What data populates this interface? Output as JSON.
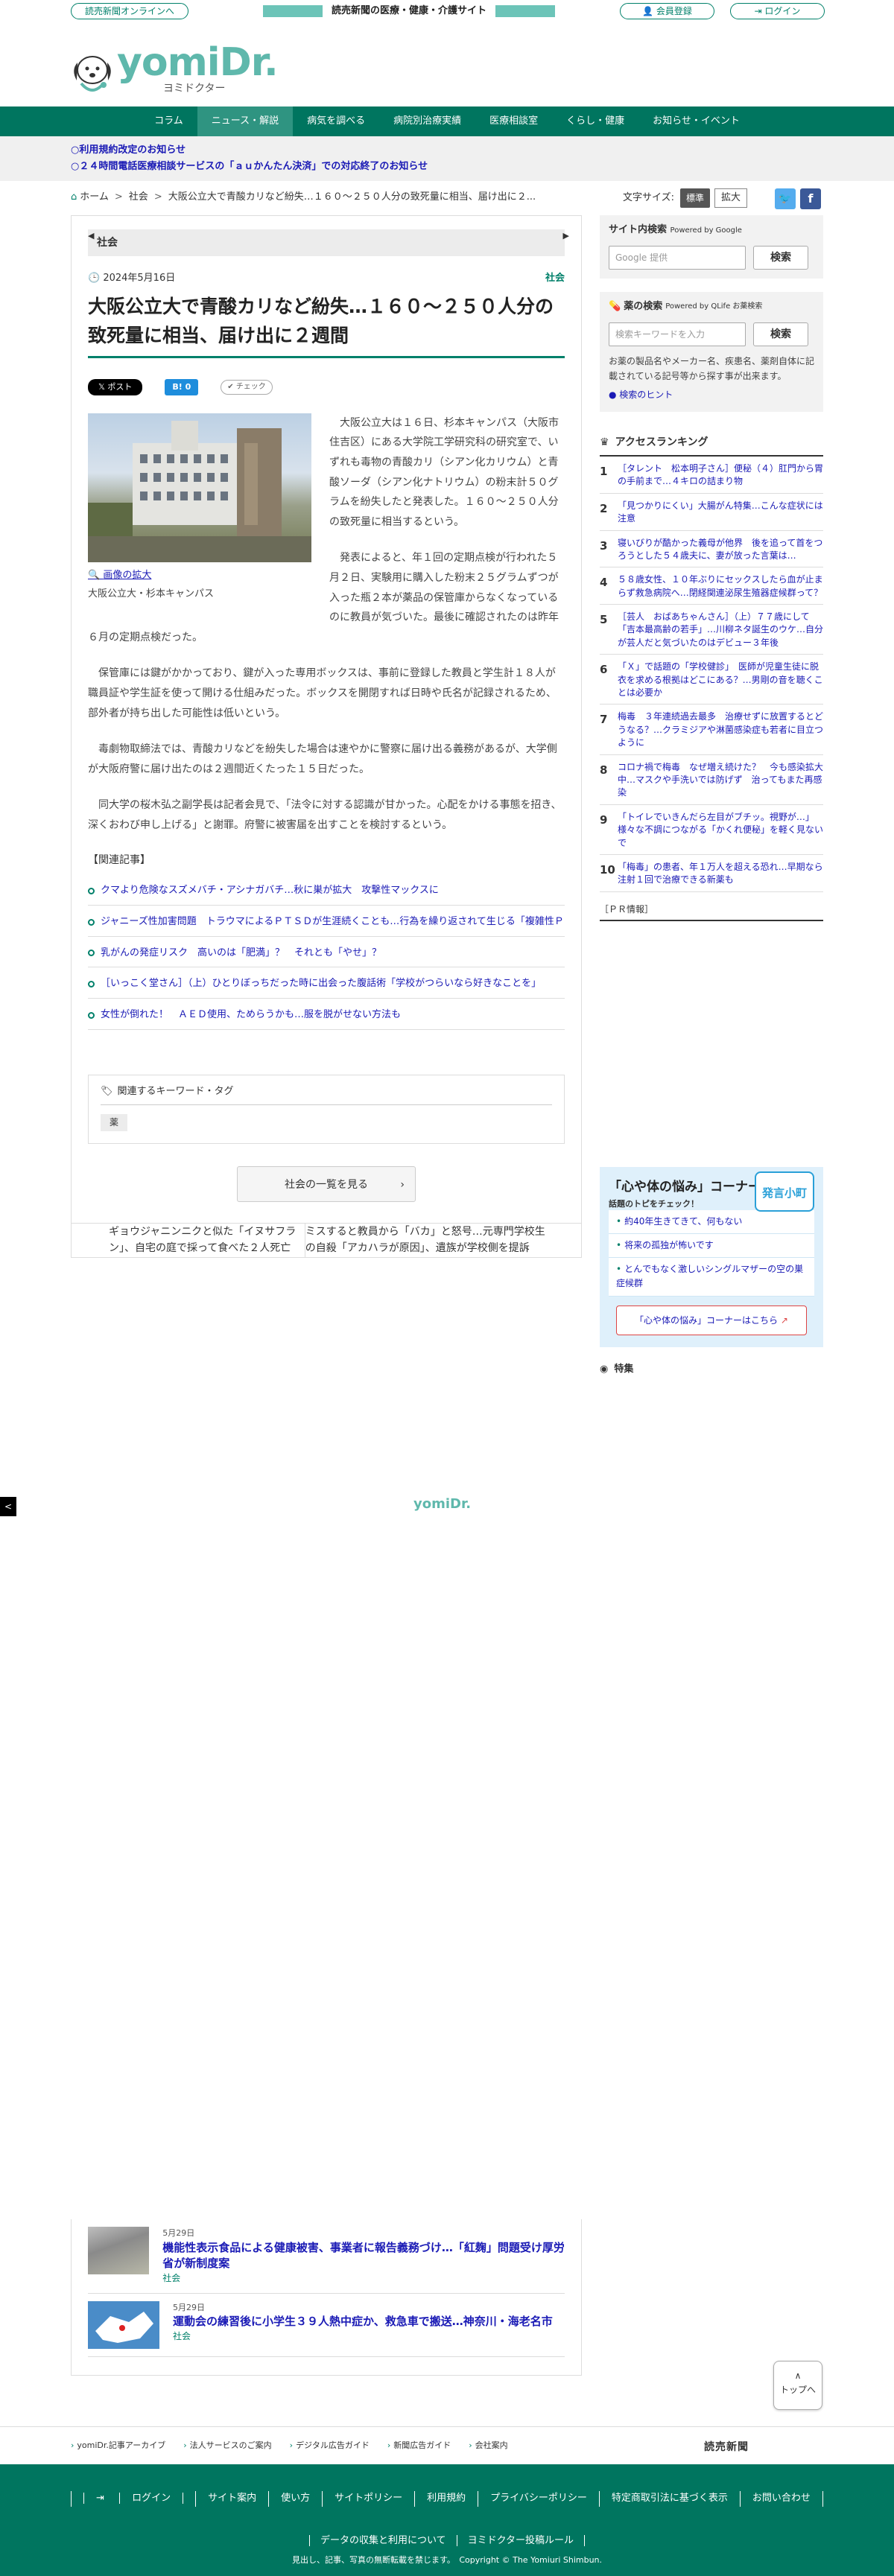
{
  "top": {
    "online": "読売新聞オンラインへ",
    "tagline": "読売新聞の医療・健康・介護サイト",
    "register": "会員登録",
    "login": "ログイン"
  },
  "logo": {
    "mark": "yomiDr.",
    "kana": "ヨミドクター"
  },
  "nav": [
    "コラム",
    "ニュース・解説",
    "病気を調べる",
    "病院別治療実績",
    "医療相談室",
    "くらし・健康",
    "お知らせ・イベント"
  ],
  "notices": [
    "○利用規約改定のお知らせ",
    "○２４時間電話医療相談サービスの「ａｕかんたん決済」での対応終了のお知らせ"
  ],
  "breadcrumb": {
    "home": "ホーム",
    "cat": "社会",
    "current": "大阪公立大で青酸カリなど紛失…１６０～２５０人分の致死量に相当、届け出に２..."
  },
  "textsize": {
    "label": "文字サイズ:",
    "std": "標準",
    "big": "拡大"
  },
  "article": {
    "section": "社会",
    "date": "2024年5月16日",
    "category": "社会",
    "title": "大阪公立大で青酸カリなど紛失…１６０～２５０人分の致死量に相当、届け出に２週間",
    "share_x": "ポスト",
    "share_b": "B! 0",
    "share_check": "チェック",
    "photo_zoom": "画像の拡大",
    "photo_caption": "大阪公立大・杉本キャンパス",
    "paragraphs": [
      "大阪公立大は１６日、杉本キャンパス（大阪市住吉区）にある大学院工学研究科の研究室で、いずれも毒物の青酸カリ（シアン化カリウム）と青酸ソーダ（シアン化ナトリウム）の粉末計５０グラムを紛失したと発表した。１６０～２５０人分の致死量に相当するという。",
      "発表によると、年１回の定期点検が行われた５月２日、実験用に購入した粉末２５グラムずつが入った瓶２本が薬品の保管庫からなくなっているのに教員が気づいた。最後に確認されたのは昨年６月の定期点検だった。",
      "保管庫には鍵がかかっており、鍵が入った専用ボックスは、事前に登録した教員と学生計１８人が職員証や学生証を使って開ける仕組みだった。ボックスを開閉すれば日時や氏名が記録されるため、部外者が持ち出した可能性は低いという。",
      "毒劇物取締法では、青酸カリなどを紛失した場合は速やかに警察に届け出る義務があるが、大学側が大阪府警に届け出たのは２週間近くたった１５日だった。",
      "同大学の桜木弘之副学長は記者会見で、「法令に対する認識が甘かった。心配をかける事態を招き、深くおわび申し上げる」と謝罪。府警に被害届を出すことを検討するという。"
    ]
  },
  "related": {
    "title": "【関連記事】",
    "items": [
      "クマより危険なスズメバチ・アシナガバチ…秋に巣が拡大　攻撃性マックスに",
      "ジャニーズ性加害問題　トラウマによるＰＴＳＤが生涯続くことも…行為を繰り返されて生じる「複雑性ＰＴＳＤ」",
      "乳がんの発症リスク　高いのは「肥満」？　それとも「やせ」？",
      "［いっこく堂さん］（上）ひとりぼっちだった時に出会った腹話術「学校がつらいなら好きなことを」",
      "女性が倒れた！　ＡＥＤ使用、ためらうかも…服を脱がせない方法も"
    ]
  },
  "keywords": {
    "title": "関連するキーワード・タグ",
    "tags": [
      "薬"
    ]
  },
  "more_button": "社会の一覧を見る",
  "prevnext": {
    "prev": "ギョウジャニンニクと似た「イヌサフラン」、自宅の庭で採って食べた２人死亡",
    "next": "ミスすると教員から「バカ」と怒号…元専門学校生の自殺「アカハラが原因」、遺族が学校側を提訴"
  },
  "sidebar": {
    "site_search": "サイト内検索",
    "powered_google": "Powered by Google",
    "google_placeholder": "Google 提供",
    "search_btn": "検索",
    "drug_search": "薬の検索",
    "powered_qlife": "Powered by QLife お薬検索",
    "drug_placeholder": "検索キーワードを入力",
    "drug_desc": "お薬の製品名やメーカー名、疾患名、薬剤自体に記載されている記号等から探す事が出来ます。",
    "drug_hint": "検索のヒント",
    "ranking_title": "アクセスランキング",
    "ranking": [
      {
        "n": "1",
        "t": "［タレント　松本明子さん］便秘（４）肛門から胃の手前まで…４キロの詰まり物"
      },
      {
        "n": "2",
        "t": "「見つかりにくい」大腸がん特集…こんな症状には注意"
      },
      {
        "n": "3",
        "t": "寝いびりが酷かった義母が他界　後を追って首をつろうとした５４歳夫に、妻が放った言葉は…"
      },
      {
        "n": "4",
        "t": "５８歳女性、１０年ぶりにセックスしたら血が止まらず救急病院へ…閉経関連泌尿生殖器症候群って？"
      },
      {
        "n": "5",
        "t": "［芸人　おばあちゃんさん］（上）７７歳にして「吉本最高齢の若手」…川柳ネタ誕生のウケ…自分が芸人だと気づいたのはデビュー３年後"
      },
      {
        "n": "6",
        "t": "「Ｘ」で話題の「学校健診」　医師が児童生徒に脱衣を求める根拠はどこにある？…男剛の音を聴くことは必要か"
      },
      {
        "n": "7",
        "t": "梅毒　３年連続過去最多　治療せずに放置するとどうなる？…クラミジアや淋菌感染症も若者に目立つように"
      },
      {
        "n": "8",
        "t": "コロナ禍で梅毒　なぜ増え続けた？　今も感染拡大中…マスクや手洗いでは防げず　治ってもまた再感染"
      },
      {
        "n": "9",
        "t": "「トイレでいきんだら左目がブチッ。視野が…」様々な不調につながる「かくれ便秘」を軽く見ないで"
      },
      {
        "n": "10",
        "t": "「梅毒」の患者、年１万人を超える恐れ…早期なら注射１回で治療できる新薬も"
      }
    ],
    "pr": "［ＰＲ情報］",
    "kokoro_title": "「心や体の悩み」コーナー",
    "kokoro_sub": "話題のトピをチェック！",
    "kokoro_badge": "発言小町",
    "kokoro_items": [
      "約40年生きてきて、何もない",
      "将来の孤独が怖いです",
      "とんでもなく激しいシングルマザーの空の巣症候群"
    ],
    "kokoro_link": "「心や体の悩み」コーナーはこちら",
    "special": "特集"
  },
  "midlogo": "yomiDr.",
  "bottom": [
    {
      "date": "5月29日",
      "title": "機能性表示食品による健康被害、事業者に報告義務づけ…「紅麹」問題受け厚労省が新制度案",
      "cat": "社会"
    },
    {
      "date": "5月29日",
      "title": "運動会の練習後に小学生３９人熱中症か、救急車で搬送…神奈川・海老名市",
      "cat": "社会"
    }
  ],
  "totop": "トップへ",
  "footlinks": [
    "yomiDr.記事アーカイブ",
    "法人サービスのご案内",
    "デジタル広告ガイド",
    "新聞広告ガイド",
    "会社案内"
  ],
  "yomiuri": "読売新聞",
  "footer": {
    "nav": [
      "ログイン",
      "サイト案内",
      "使い方",
      "サイトポリシー",
      "利用規約",
      "プライバシーポリシー",
      "特定商取引法に基づく表示",
      "お問い合わせ"
    ],
    "nav2": [
      "データの収集と利用について",
      "ヨミドクター投稿ルール"
    ],
    "copy": "見出し、記事、写真の無断転載を禁じます。　Copyright © The Yomiuri Shimbun."
  }
}
